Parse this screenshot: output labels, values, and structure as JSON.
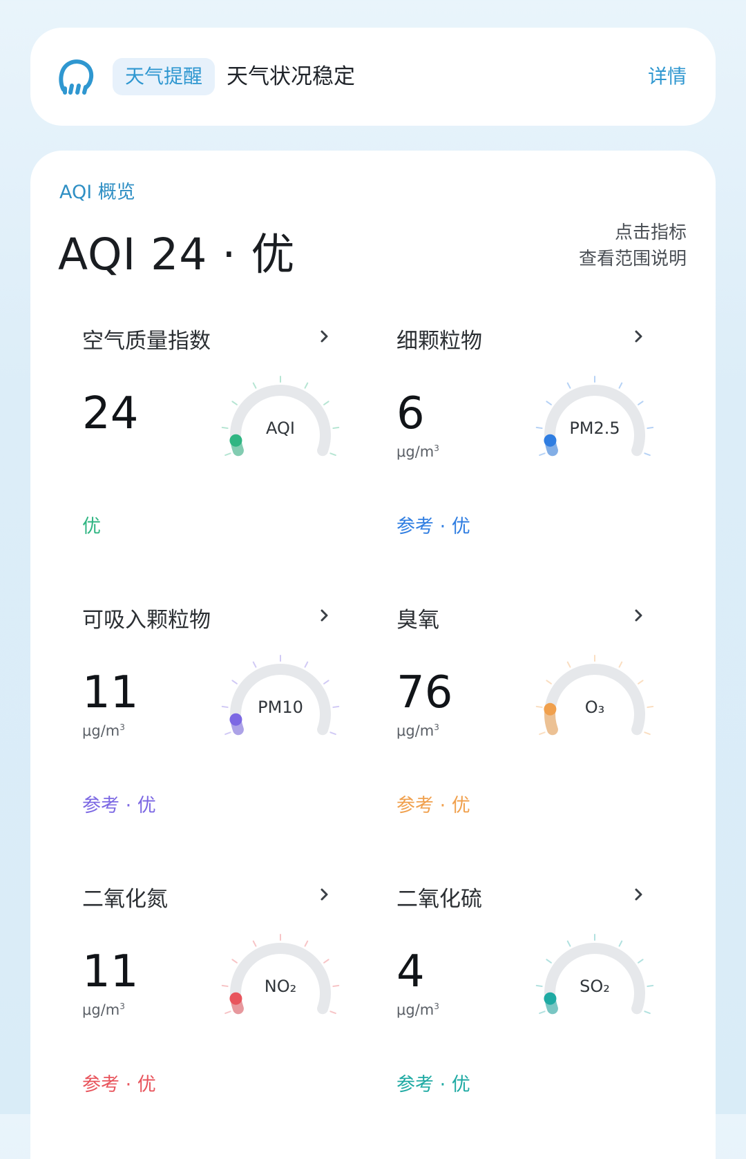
{
  "alert": {
    "tag": "天气提醒",
    "text": "天气状况稳定",
    "detail": "详情"
  },
  "aqi_overview": {
    "section_label": "AQI 概览",
    "headline": "AQI 24 · 优",
    "hint_line1": "点击指标",
    "hint_line2": "查看范围说明"
  },
  "tiles": [
    {
      "name": "空气质量指数",
      "value": "24",
      "unit": "",
      "level": "优",
      "gauge_label": "AQI",
      "color": "#2fb582",
      "fraction": 0.0
    },
    {
      "name": "细颗粒物",
      "value": "6",
      "unit": "μg/m",
      "level": "参考 · 优",
      "gauge_label": "PM2.5",
      "color": "#2f7de1",
      "fraction": 0.0
    },
    {
      "name": "可吸入颗粒物",
      "value": "11",
      "unit": "μg/m",
      "level": "参考 · 优",
      "gauge_label": "PM10",
      "color": "#7c68e3",
      "fraction": 0.0
    },
    {
      "name": "臭氧",
      "value": "76",
      "unit": "μg/m",
      "level": "参考 · 优",
      "gauge_label": "O₃",
      "color": "#f0a04d",
      "fraction": 0.12
    },
    {
      "name": "二氧化氮",
      "value": "11",
      "unit": "μg/m",
      "level": "参考 · 优",
      "gauge_label": "NO₂",
      "color": "#e8555d",
      "fraction": 0.0
    },
    {
      "name": "二氧化硫",
      "value": "4",
      "unit": "μg/m",
      "level": "参考 · 优",
      "gauge_label": "SO₂",
      "color": "#1faaa3",
      "fraction": 0.0
    }
  ],
  "unit_superscript": "3",
  "colors": {
    "accent": "#2f97d0",
    "track": "#e6e8eb"
  }
}
